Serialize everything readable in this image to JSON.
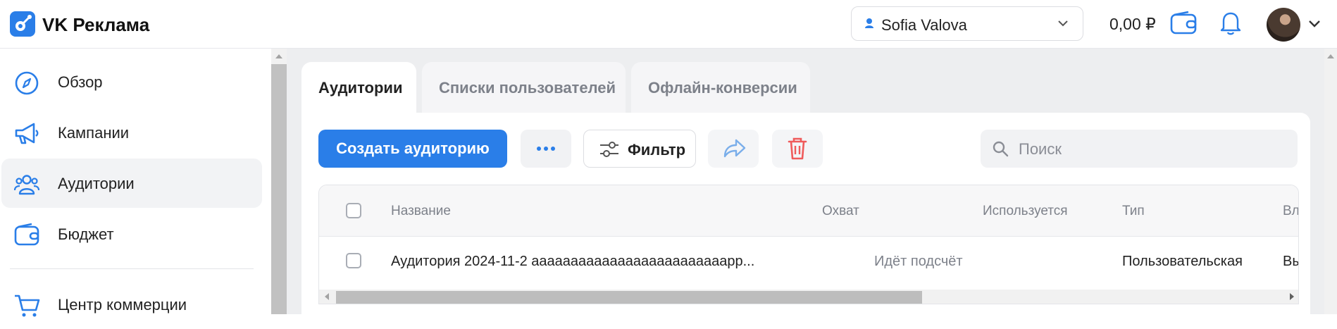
{
  "header": {
    "brand": "VK Реклама",
    "account_name": "Sofia Valova",
    "balance": "0,00 ₽",
    "icons": [
      "vk-ads-logo-icon",
      "user-icon",
      "chevron-down-icon",
      "wallet-icon",
      "bell-icon",
      "avatar",
      "chevron-down-icon"
    ]
  },
  "sidebar": {
    "items": [
      {
        "label": "Обзор",
        "icon": "compass-icon"
      },
      {
        "label": "Кампании",
        "icon": "megaphone-icon"
      },
      {
        "label": "Аудитории",
        "icon": "users-icon",
        "active": true
      },
      {
        "label": "Бюджет",
        "icon": "wallet-icon"
      },
      {
        "label": "Центр коммерции",
        "icon": "cart-icon"
      }
    ]
  },
  "tabs": [
    {
      "label": "Аудитории",
      "active": true
    },
    {
      "label": "Списки пользователей"
    },
    {
      "label": "Офлайн-конверсии"
    }
  ],
  "toolbar": {
    "create_label": "Создать аудиторию",
    "filter_label": "Фильтр",
    "search_placeholder": "Поиск"
  },
  "table": {
    "columns": [
      "Название",
      "Охват",
      "Используется",
      "Тип",
      "Вл"
    ],
    "rows": [
      {
        "name": "Аудитория 2024-11-2 ааааааааааааааааааааааааарр...",
        "reach": "Идёт подсчёт",
        "used": "",
        "type": "Пользовательская",
        "owner": "Вы"
      }
    ]
  },
  "colors": {
    "accent": "#2a7ee8",
    "danger": "#ef5b5b",
    "share": "#7aaeea"
  }
}
